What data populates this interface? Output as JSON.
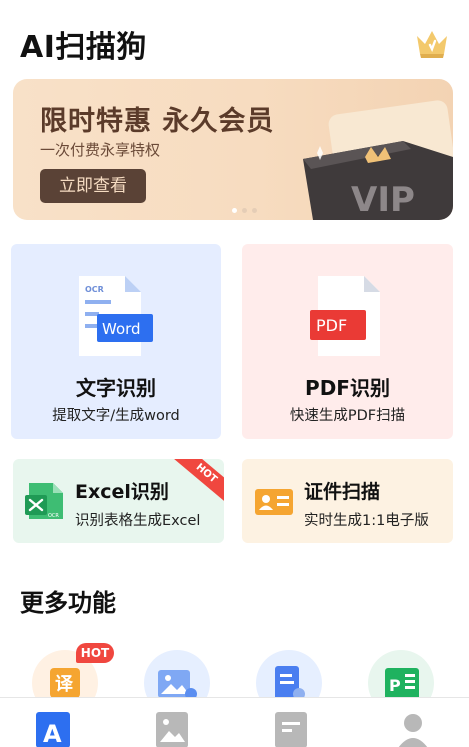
{
  "app": {
    "title": "AI扫描狗"
  },
  "banner": {
    "title": "限时特惠 永久会员",
    "subtitle": "一次付费永享特权",
    "button_label": "立即查看",
    "art_text": "VIP",
    "slides": 3,
    "active_slide": 0
  },
  "features": {
    "ocr": {
      "title": "文字识别",
      "subtitle": "提取文字/生成word",
      "icon_tag": "OCR",
      "icon_label": "Word"
    },
    "pdf": {
      "title": "PDF识别",
      "subtitle": "快速生成PDF扫描",
      "icon_label": "PDF"
    },
    "excel": {
      "title": "Excel识别",
      "subtitle": "识别表格生成Excel",
      "badge": "HOT",
      "icon_tag": "OCR"
    },
    "id_scan": {
      "title": "证件扫描",
      "subtitle": "实时生成1:1电子版"
    }
  },
  "more": {
    "title": "更多功能",
    "hot_badge": "HOT",
    "translate_glyph": "译",
    "ppt_glyph": "P"
  },
  "tabs": [
    {
      "icon": "text-scan-icon",
      "glyph": "A",
      "active": true
    },
    {
      "icon": "image-icon",
      "active": false
    },
    {
      "icon": "document-icon",
      "active": false
    },
    {
      "icon": "profile-icon",
      "active": false
    }
  ],
  "colors": {
    "accent": "#2d6ff0",
    "banner_bg": "#f8e1c8",
    "banner_text": "#5b3b2a",
    "hot": "#f0473f",
    "pdf_red": "#ea3a35",
    "excel_green": "#1f9a55",
    "id_orange": "#f5a531"
  }
}
